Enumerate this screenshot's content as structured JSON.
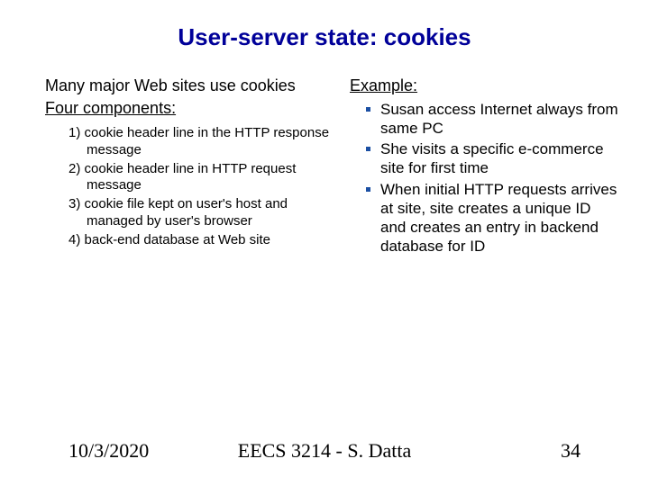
{
  "title": "User-server state: cookies",
  "left": {
    "lead": "Many major Web sites use cookies",
    "four_heading": "Four components:",
    "components": {
      "c1": "1) cookie header line in the HTTP response message",
      "c2": "2) cookie header line in HTTP request message",
      "c3": "3) cookie file kept on user's host and managed by user's browser",
      "c4": "4) back-end database at Web site"
    }
  },
  "right": {
    "example_heading": "Example:",
    "items": {
      "i1": "Susan access Internet always from same PC",
      "i2": "She visits a specific e-commerce site for first time",
      "i3": "When initial HTTP requests arrives at site, site creates a unique ID and creates an entry in backend database for ID"
    }
  },
  "footer": {
    "date": "10/3/2020",
    "course": "EECS 3214 - S. Datta",
    "page": "34"
  }
}
